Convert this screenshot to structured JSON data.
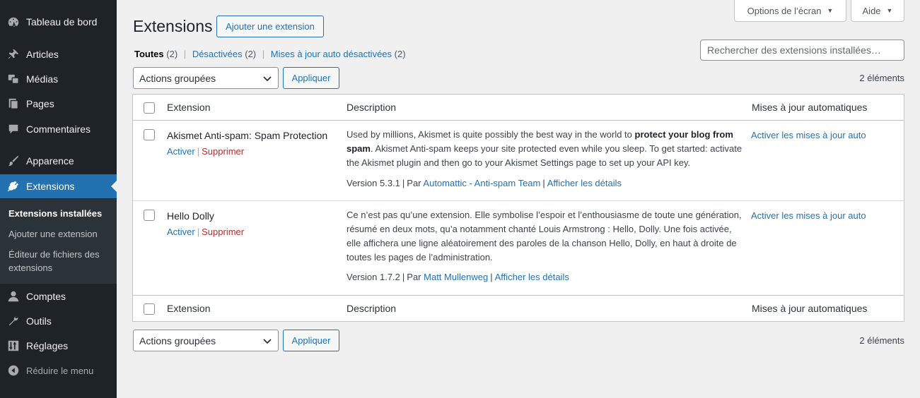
{
  "sidebar": {
    "items": [
      {
        "label": "Tableau de bord",
        "icon": "dashboard-icon"
      },
      {
        "label": "Articles",
        "icon": "pin-icon"
      },
      {
        "label": "Médias",
        "icon": "media-icon"
      },
      {
        "label": "Pages",
        "icon": "pages-icon"
      },
      {
        "label": "Commentaires",
        "icon": "comment-icon"
      },
      {
        "label": "Apparence",
        "icon": "brush-icon"
      },
      {
        "label": "Extensions",
        "icon": "plugin-icon"
      },
      {
        "label": "Comptes",
        "icon": "user-icon"
      },
      {
        "label": "Outils",
        "icon": "wrench-icon"
      },
      {
        "label": "Réglages",
        "icon": "settings-icon"
      },
      {
        "label": "Réduire le menu",
        "icon": "collapse-icon"
      }
    ],
    "submenu": [
      {
        "label": "Extensions installées"
      },
      {
        "label": "Ajouter une extension"
      },
      {
        "label": "Éditeur de fichiers des extensions"
      }
    ]
  },
  "header": {
    "title": "Extensions",
    "add_button": "Ajouter une extension",
    "screen_options": "Options de l’écran",
    "help": "Aide"
  },
  "filters": [
    {
      "label": "Toutes",
      "count": "(2)"
    },
    {
      "label": "Désactivées",
      "count": "(2)"
    },
    {
      "label": "Mises à jour auto désactivées",
      "count": "(2)"
    }
  ],
  "search": {
    "placeholder": "Rechercher des extensions installées…"
  },
  "bulk": {
    "select_value": "Actions groupées",
    "apply": "Appliquer",
    "count": "2 éléments"
  },
  "table": {
    "columns": {
      "name": "Extension",
      "description": "Description",
      "auto": "Mises à jour automatiques"
    },
    "plugins": [
      {
        "name": "Akismet Anti-spam: Spam Protection",
        "activate": "Activer",
        "delete": "Supprimer",
        "desc_pre": "Used by millions, Akismet is quite possibly the best way in the world to ",
        "desc_bold": "protect your blog from spam",
        "desc_post": ". Akismet Anti-spam keeps your site protected even while you sleep. To get started: activate the Akismet plugin and then go to your Akismet Settings page to set up your API key.",
        "version": "Version 5.3.1",
        "by": "Par",
        "author": "Automattic - Anti-spam Team",
        "details": "Afficher les détails",
        "auto": "Activer les mises à jour auto"
      },
      {
        "name": "Hello Dolly",
        "activate": "Activer",
        "delete": "Supprimer",
        "desc_pre": "Ce n’est pas qu’une extension. Elle symbolise l’espoir et l’enthousiasme de toute une génération, résumé en deux mots, qu’a notamment chanté Louis Armstrong : Hello, Dolly. Une fois activée, elle affichera une ligne aléatoirement des paroles de la chanson Hello, Dolly, en haut à droite de toutes les pages de l’administration.",
        "desc_bold": "",
        "desc_post": "",
        "version": "Version 1.7.2",
        "by": "Par",
        "author": "Matt Mullenweg",
        "details": "Afficher les détails",
        "auto": "Activer les mises à jour auto"
      }
    ]
  },
  "colors": {
    "sidebar": "#1d2327",
    "accent": "#2271b1",
    "delete": "#b32d2e"
  }
}
